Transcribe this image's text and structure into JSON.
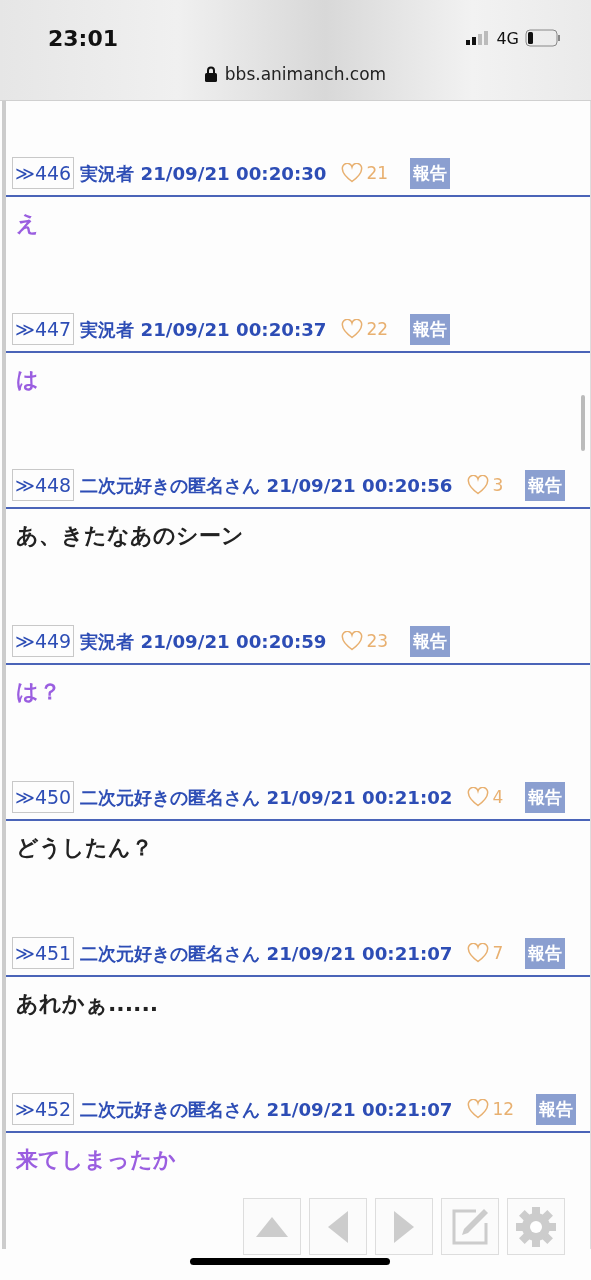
{
  "status_bar": {
    "time": "23:01",
    "network": "4G"
  },
  "address_bar": {
    "url": "bbs.animanch.com"
  },
  "posts": [
    {
      "kind": "streamer",
      "number": "≫446",
      "name": "実況者",
      "date": "21/09/21 00:20:30",
      "likes": "21",
      "report": "報告",
      "body": "え"
    },
    {
      "kind": "streamer",
      "number": "≫447",
      "name": "実況者",
      "date": "21/09/21 00:20:37",
      "likes": "22",
      "report": "報告",
      "body": "は"
    },
    {
      "kind": "anonymous",
      "number": "≫448",
      "name": "二次元好きの匿名さん",
      "date": "21/09/21 00:20:56",
      "likes": "3",
      "report": "報告",
      "body": "あ、きたなあのシーン"
    },
    {
      "kind": "streamer",
      "number": "≫449",
      "name": "実況者",
      "date": "21/09/21 00:20:59",
      "likes": "23",
      "report": "報告",
      "body": "は？"
    },
    {
      "kind": "anonymous",
      "number": "≫450",
      "name": "二次元好きの匿名さん",
      "date": "21/09/21 00:21:02",
      "likes": "4",
      "report": "報告",
      "body": "どうしたん？"
    },
    {
      "kind": "anonymous",
      "number": "≫451",
      "name": "二次元好きの匿名さん",
      "date": "21/09/21 00:21:07",
      "likes": "7",
      "report": "報告",
      "body": "あれかぁ......"
    },
    {
      "kind": "streamer",
      "number": "≫452",
      "name": "二次元好きの匿名さん",
      "date": "21/09/21 00:21:07",
      "likes": "12",
      "report": "報告",
      "body": "来てしまったか"
    }
  ]
}
